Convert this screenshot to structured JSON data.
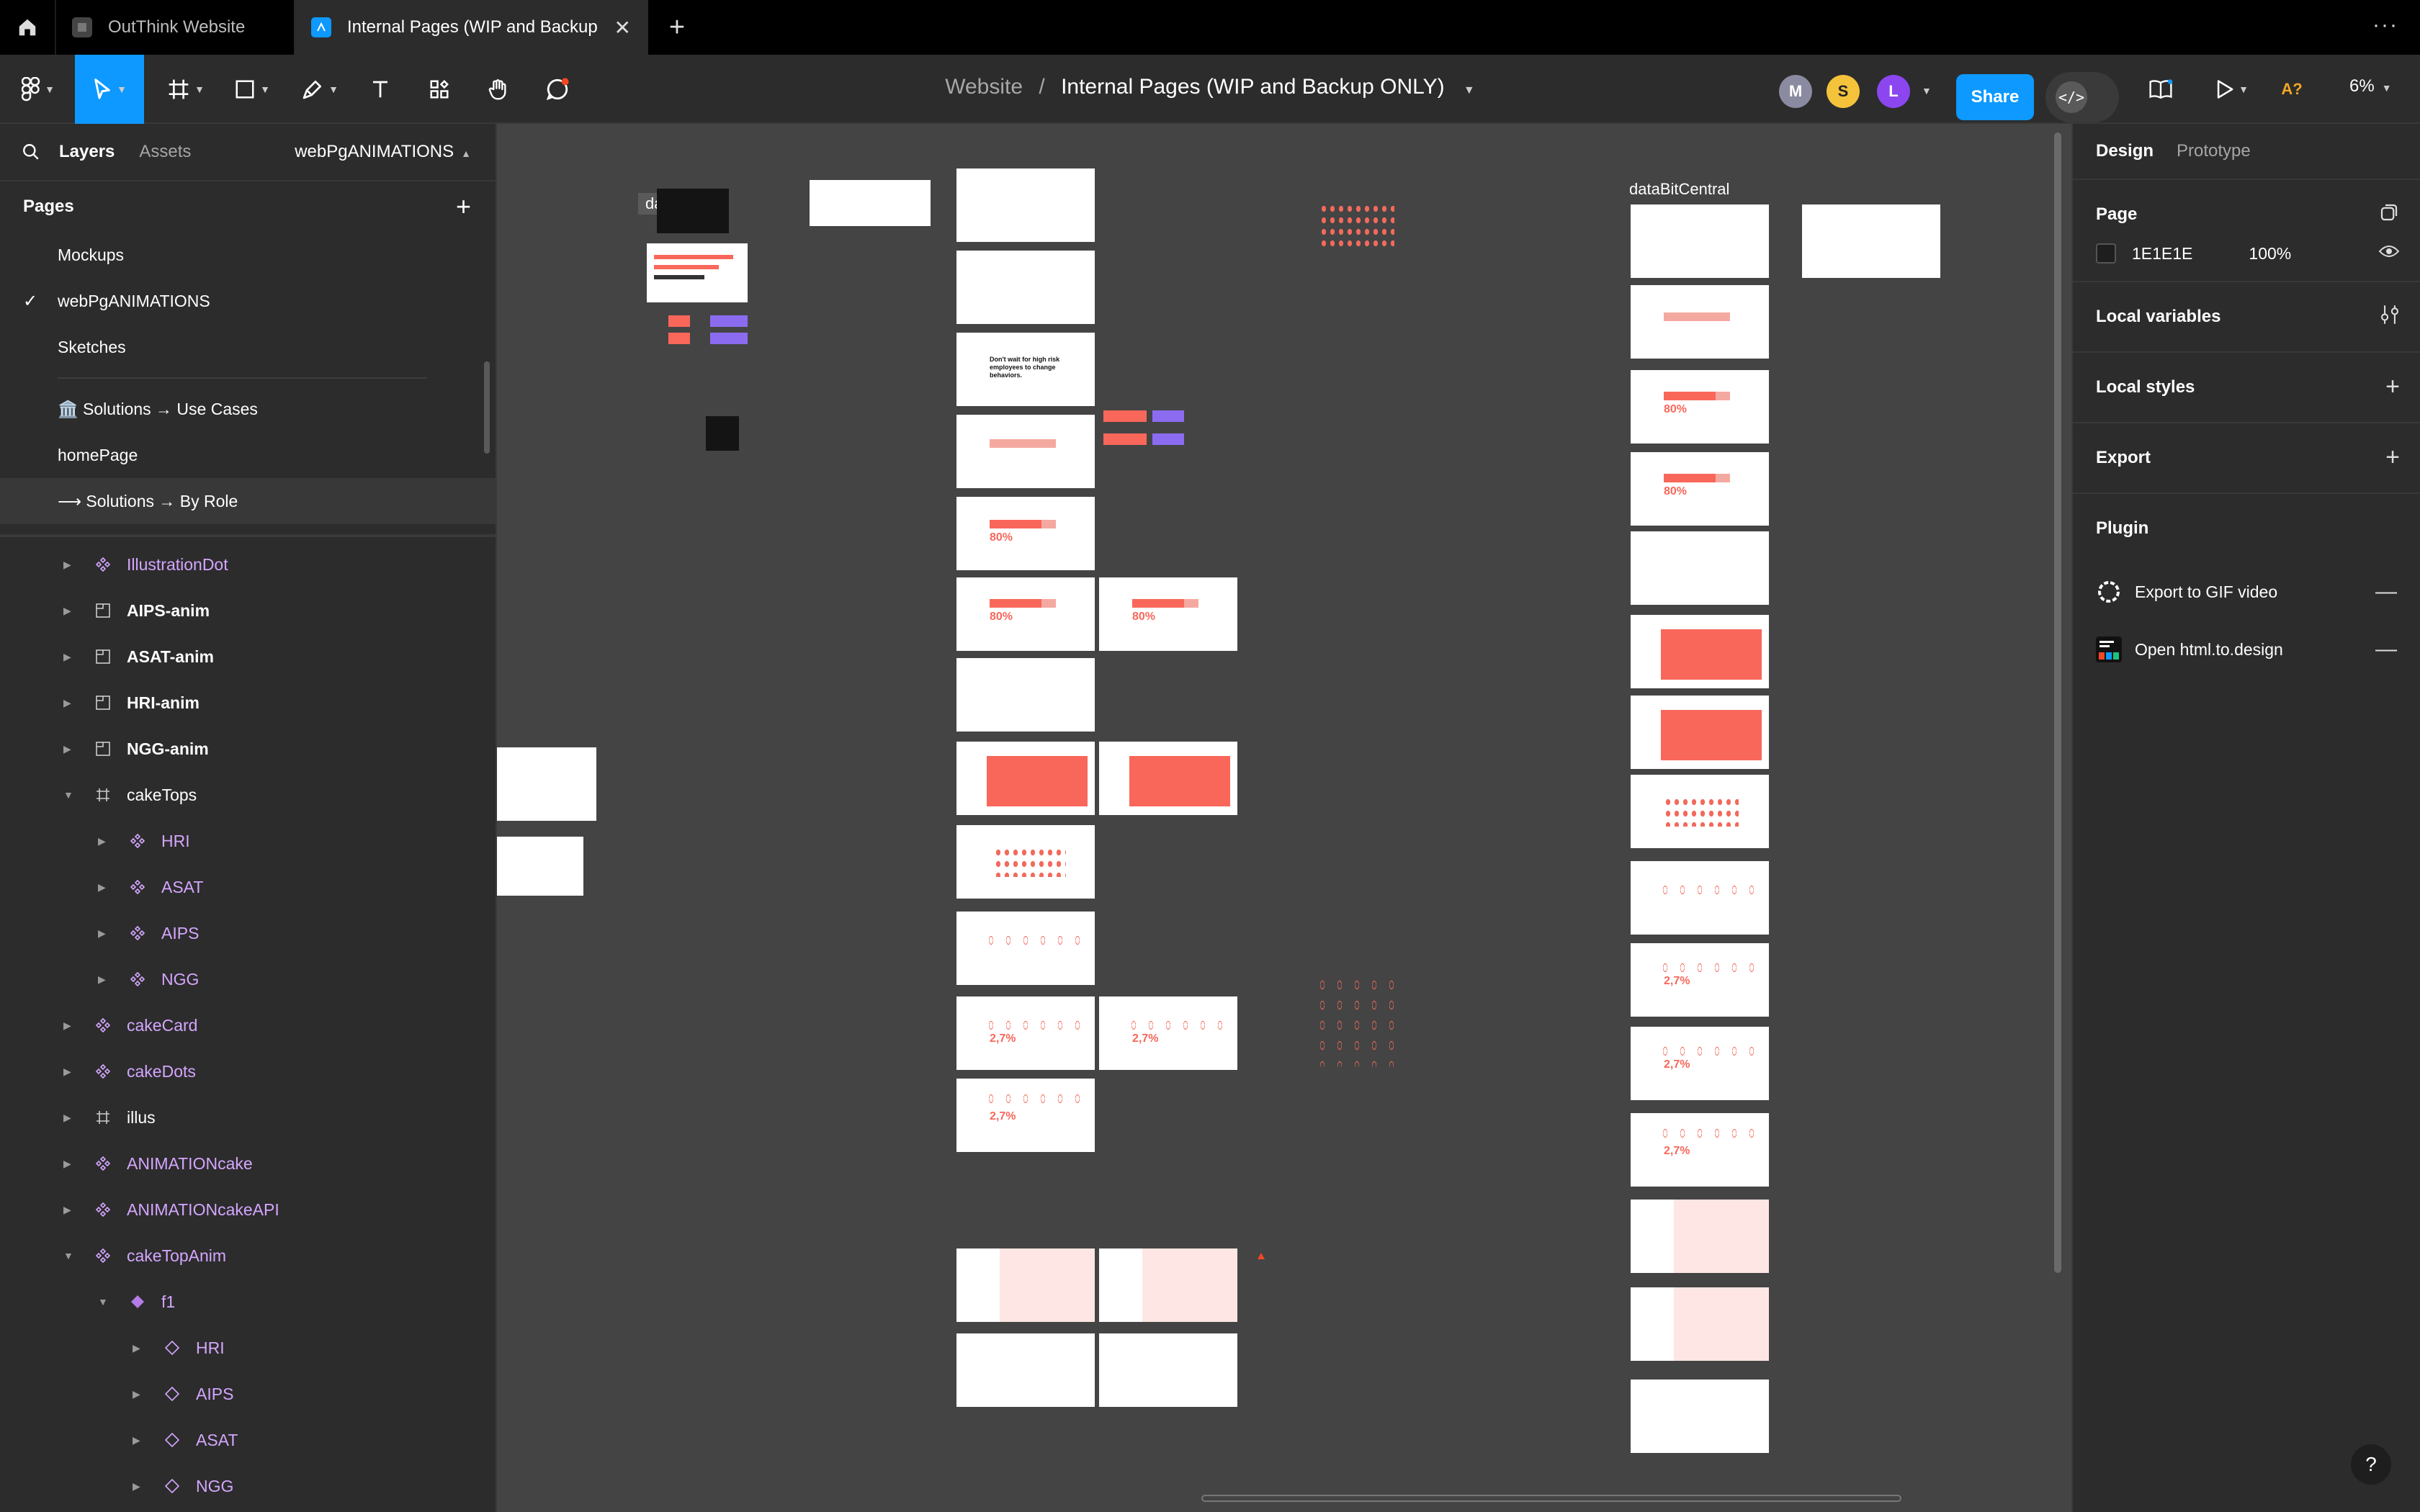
{
  "tabs": {
    "home_icon": "home-icon",
    "items": [
      {
        "title": "OutThink Website",
        "active": false
      },
      {
        "title": "Internal Pages (WIP and Backup O",
        "active": true
      }
    ],
    "new_tab": "+",
    "more": "···"
  },
  "toolbar": {
    "breadcrumb_project": "Website",
    "breadcrumb_separator": "/",
    "breadcrumb_file": "Internal Pages (WIP and Backup ONLY)",
    "avatars": [
      {
        "initial": "M",
        "color": "#8a8aa0"
      },
      {
        "initial": "S",
        "color": "#f5c23b"
      },
      {
        "initial": "L",
        "color": "#8b46f0"
      }
    ],
    "share_label": "Share",
    "devmode_icon": "</>",
    "prompt_label": "A?",
    "zoom": "6%"
  },
  "leftbar": {
    "tab_layers": "Layers",
    "tab_assets": "Assets",
    "current_page": "webPgANIMATIONS",
    "pages_title": "Pages",
    "pages": [
      {
        "label": "Mockups"
      },
      {
        "label": "webPgANIMATIONS"
      },
      {
        "label": "Sketches"
      },
      {
        "label": "🏛️ Solutions → Use Cases"
      },
      {
        "label": "homePage"
      },
      {
        "label": "⟶ Solutions → By Role"
      }
    ],
    "layers": [
      {
        "label": "IllustrationDot"
      },
      {
        "label": "AIPS-anim"
      },
      {
        "label": "ASAT-anim"
      },
      {
        "label": "HRI-anim"
      },
      {
        "label": "NGG-anim"
      },
      {
        "label": "cakeTops"
      },
      {
        "label": "HRI"
      },
      {
        "label": "ASAT"
      },
      {
        "label": "AIPS"
      },
      {
        "label": "NGG"
      },
      {
        "label": "cakeCard"
      },
      {
        "label": "cakeDots"
      },
      {
        "label": "illus"
      },
      {
        "label": "ANIMATIONcake"
      },
      {
        "label": "ANIMATIONcakeAPI"
      },
      {
        "label": "cakeTopAnim"
      },
      {
        "label": "f1"
      },
      {
        "label": "HRI"
      },
      {
        "label": "AIPS"
      },
      {
        "label": "ASAT"
      },
      {
        "label": "NGG"
      }
    ]
  },
  "canvas": {
    "label_data": "data",
    "label_databit": "dataBitCentral",
    "stat_80": "80%",
    "stat_27": "2,7%",
    "headline": "Don't wait for high risk employees to change behaviors."
  },
  "rightbar": {
    "tab_design": "Design",
    "tab_prototype": "Prototype",
    "page_section": "Page",
    "page_color": "1E1E1E",
    "page_opacity": "100%",
    "local_variables": "Local variables",
    "local_styles": "Local styles",
    "export": "Export",
    "plugin": "Plugin",
    "plugins": [
      {
        "label": "Export to GIF video"
      },
      {
        "label": "Open html.to.design"
      }
    ],
    "help": "?"
  },
  "colors": {
    "accent": "#0d99ff",
    "component_purple": "#d4a6ff",
    "coral": "#f8675a",
    "canvas_bg": "#444444"
  }
}
